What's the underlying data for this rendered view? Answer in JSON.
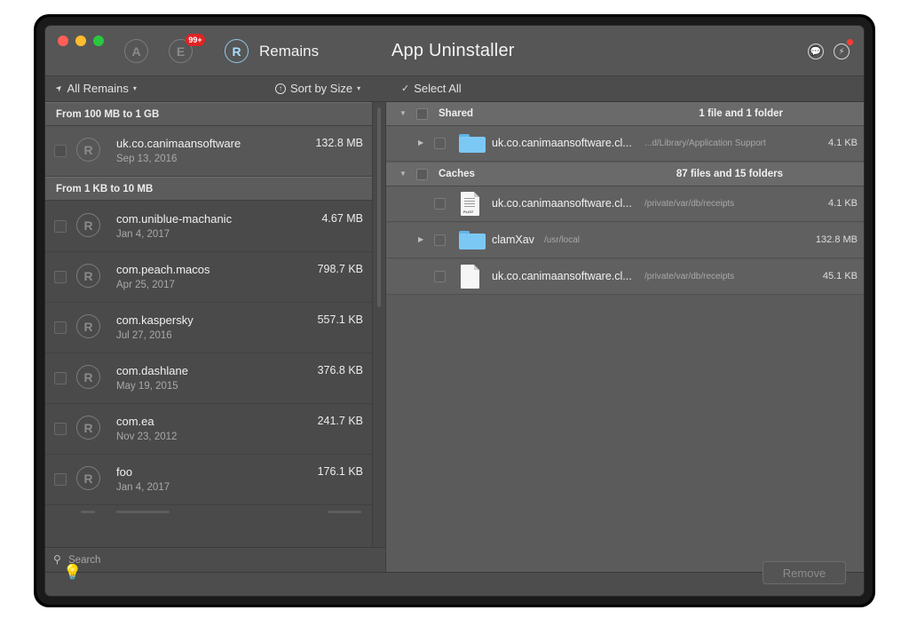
{
  "window": {
    "title": "App Uninstaller"
  },
  "mode_tabs": [
    {
      "name": "applications",
      "icon": "A"
    },
    {
      "name": "extensions",
      "icon": "E",
      "badge": "99+"
    },
    {
      "name": "remains",
      "icon": "R",
      "label": "Remains",
      "active": true
    }
  ],
  "toolbar": {
    "filter_label": "All Remains",
    "sort_label": "Sort by Size",
    "select_all_label": "Select All"
  },
  "left_list": {
    "sections": [
      {
        "title": "From 100 MB to 1 GB",
        "items": [
          {
            "name": "uk.co.canimaansoftware",
            "date": "Sep 13, 2016",
            "size": "132.8 MB",
            "icon": "R",
            "selected": true
          }
        ]
      },
      {
        "title": "From 1 KB to 10 MB",
        "items": [
          {
            "name": "com.uniblue-machanic",
            "date": "Jan 4, 2017",
            "size": "4.67 MB",
            "icon": "R"
          },
          {
            "name": "com.peach.macos",
            "date": "Apr 25, 2017",
            "size": "798.7 KB",
            "icon": "R"
          },
          {
            "name": "com.kaspersky",
            "date": "Jul 27, 2016",
            "size": "557.1 KB",
            "icon": "R"
          },
          {
            "name": "com.dashlane",
            "date": "May 19, 2015",
            "size": "376.8 KB",
            "icon": "R"
          },
          {
            "name": "com.ea",
            "date": "Nov 23, 2012",
            "size": "241.7 KB",
            "icon": "R"
          },
          {
            "name": "foo",
            "date": "Jan 4, 2017",
            "size": "176.1 KB",
            "icon": "R"
          }
        ]
      }
    ]
  },
  "search": {
    "placeholder": "Search"
  },
  "groups": [
    {
      "name": "Shared",
      "count": "1 file and 1 folder",
      "files": [
        {
          "type": "folder",
          "name": "uk.co.canimaansoftware.cl...",
          "path": "...d/Library/Application Support",
          "size": "4.1 KB",
          "expandable": true
        }
      ]
    },
    {
      "name": "Caches",
      "count": "87 files and 15 folders",
      "files": [
        {
          "type": "plist",
          "name": "uk.co.canimaansoftware.cl...",
          "path": "/private/var/db/receipts",
          "size": "4.1 KB",
          "expandable": false
        },
        {
          "type": "folder",
          "name": "clamXav",
          "path": "/usr/local",
          "size": "132.8 MB",
          "expandable": true
        },
        {
          "type": "document",
          "name": "uk.co.canimaansoftware.cl...",
          "path": "/private/var/db/receipts",
          "size": "45.1 KB",
          "expandable": false
        }
      ]
    }
  ],
  "footer": {
    "remove_label": "Remove"
  },
  "icons": {
    "tab_a": "A",
    "tab_e": "E",
    "tab_r": "R",
    "chat": "💬",
    "feed": "⚡",
    "filter": "➤",
    "sort": "↑",
    "check": "✓",
    "disclosure_down": "▼",
    "disclosure_right": "▶",
    "search": "⚲",
    "bulb": "💡",
    "caret": "▾",
    "plist_tag": "PLIST"
  },
  "colors": {
    "accent": "#a8dcff",
    "badge": "#e02323",
    "folder": "#7cc8f5",
    "notification_dot": "#ff3a30"
  }
}
